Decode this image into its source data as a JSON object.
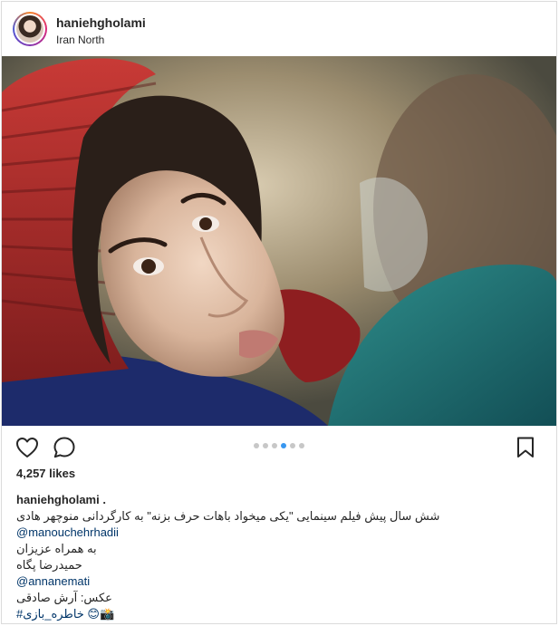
{
  "post": {
    "username": "haniehgholami",
    "location": "Iran North",
    "likes": "4,257 likes",
    "carousel": {
      "count": 6,
      "active_index": 3
    },
    "caption": {
      "author": "haniehgholami .",
      "lines": [
        "شش سال پیش فیلم سینمایی \"یکی میخواد باهات حرف بزنه\" به کارگردانی منوچهر هادی",
        "@manouchehrhadii",
        "به همراه عزیزان",
        "حمیدرضا پگاه",
        "@annanemati",
        "عکس: آرش صادقی",
        "📸😊 خاطره_بازی#"
      ]
    }
  },
  "icons": {
    "like": "heart-icon",
    "comment": "comment-icon",
    "save": "bookmark-icon"
  },
  "colors": {
    "mention": "#003569",
    "dot_active": "#3897f0",
    "dot_inactive": "#c7c7c7",
    "border": "#dbdbdb"
  }
}
